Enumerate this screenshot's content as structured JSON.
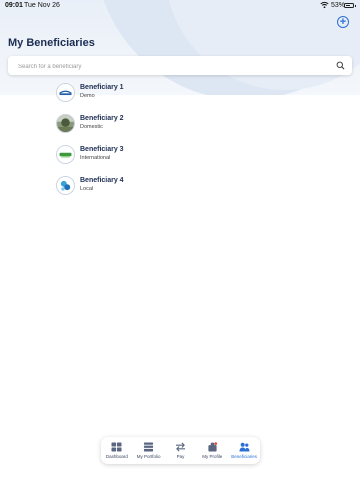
{
  "status_bar": {
    "time": "09:01",
    "date": "Tue Nov 26",
    "battery": "53%"
  },
  "header": {
    "title": "My Beneficiaries",
    "add_icon": "plus-circle-icon"
  },
  "search": {
    "placeholder": "Search for a beneficiary",
    "icon": "search-icon"
  },
  "beneficiaries": [
    {
      "name": "Beneficiary 1",
      "type": "Demo"
    },
    {
      "name": "Beneficiary 2",
      "type": "Domestic"
    },
    {
      "name": "Beneficiary 3",
      "type": "International"
    },
    {
      "name": "Beneficiary 4",
      "type": "Local"
    }
  ],
  "nav": {
    "items": [
      {
        "label": "Dashboard",
        "icon": "dashboard-icon"
      },
      {
        "label": "My Portfolio",
        "icon": "portfolio-icon"
      },
      {
        "label": "Pay",
        "icon": "transfer-arrows-icon"
      },
      {
        "label": "My Profile",
        "icon": "profile-icon"
      },
      {
        "label": "Beneficiaries",
        "icon": "people-icon",
        "active": true
      }
    ]
  },
  "colors": {
    "accent": "#2b6fd6",
    "title": "#1c2d52",
    "header_bg": "#e9eff8"
  }
}
